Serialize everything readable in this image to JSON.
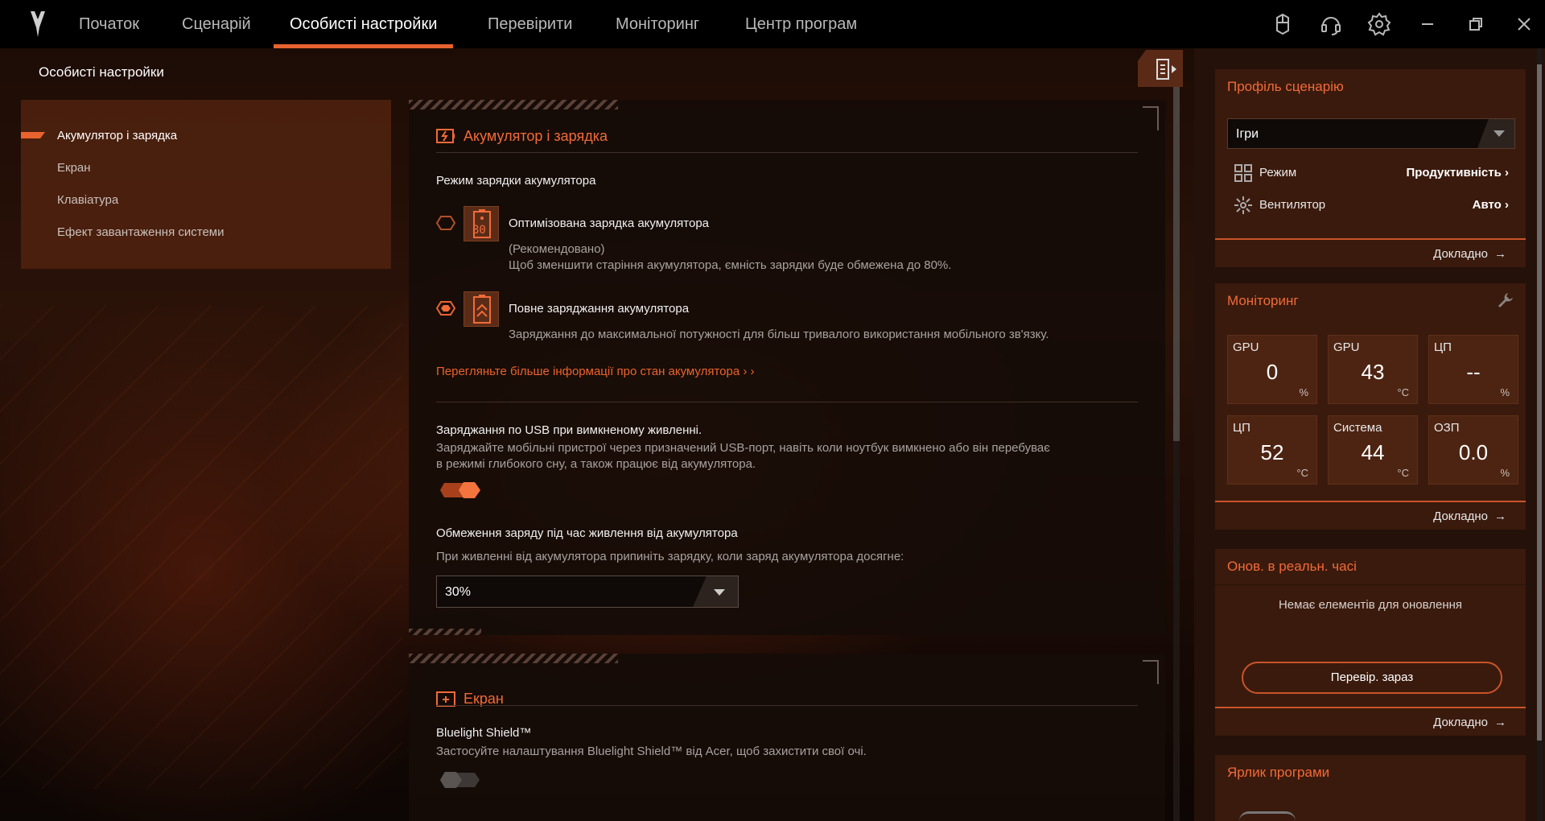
{
  "nav": {
    "tabs": [
      {
        "label": "Початок"
      },
      {
        "label": "Сценарій"
      },
      {
        "label": "Особисті настройки"
      },
      {
        "label": "Перевірити"
      },
      {
        "label": "Моніторинг"
      },
      {
        "label": "Центр програм"
      }
    ],
    "active_tab": "Особисті настройки"
  },
  "page_title": "Особисті настройки",
  "left_menu": {
    "items": [
      {
        "label": "Акумулятор і зарядка"
      },
      {
        "label": "Екран"
      },
      {
        "label": "Клавіатура"
      },
      {
        "label": "Ефект завантаження системи"
      }
    ],
    "active": "Акумулятор і зарядка"
  },
  "battery": {
    "title": "Акумулятор і зарядка",
    "mode_label": "Режим зарядки акумулятора",
    "optimized": {
      "icon_text": "80",
      "title": "Оптимізована зарядка акумулятора",
      "line1": "(Рекомендовано)",
      "line2": "Щоб зменшити старіння акумулятора, ємність зарядки буде обмежена до 80%.",
      "selected": false
    },
    "full": {
      "title": "Повне заряджання акумулятора",
      "desc": "Заряджання до максимальної потужності для більш тривалого використання мобільного зв'язку.",
      "selected": true
    },
    "info_link": "Перегляньте більше інформації про стан акумулятора ›  ›",
    "usb_title": "Заряджання по USB при вимкненому живленні.",
    "usb_desc1": "Заряджайте мобільні пристрої через призначений USB-порт, навіть коли ноутбук вимкнено або він перебуває",
    "usb_desc2": "в режимі глибокого сну, а також працює від акумулятора.",
    "usb_toggle_on": true,
    "limit_title": "Обмеження заряду під час живлення від акумулятора",
    "limit_desc": "При живленні від акумулятора припиніть зарядку, коли заряд акумулятора досягне:",
    "limit_value": "30%"
  },
  "screen": {
    "title": "Екран",
    "bluelight_title": "Bluelight Shield™",
    "bluelight_desc": "Застосуйте налаштування Bluelight Shield™ від Acer, щоб захистити свої очі.",
    "bluelight_on": false
  },
  "profile": {
    "title": "Профіль сценарію",
    "selected": "Ігри",
    "mode_label": "Режим",
    "mode_value": "Продуктивність  ›",
    "fan_label": "Вентилятор",
    "fan_value": "Авто  ›",
    "more": "Докладно"
  },
  "monitoring": {
    "title": "Моніторинг",
    "tiles": [
      {
        "label": "GPU",
        "value": "0",
        "unit": "%"
      },
      {
        "label": "GPU",
        "value": "43",
        "unit": "°C"
      },
      {
        "label": "ЦП",
        "value": "--",
        "unit": "%"
      },
      {
        "label": "ЦП",
        "value": "52",
        "unit": "°C"
      },
      {
        "label": "Система",
        "value": "44",
        "unit": "°C"
      },
      {
        "label": "ОЗП",
        "value": "0.0",
        "unit": "%"
      }
    ],
    "more": "Докладно"
  },
  "realtime": {
    "title": "Онов. в реальн. часі",
    "empty": "Немає елементів для оновлення",
    "button": "Перевір. зараз",
    "more": "Докладно"
  },
  "shortcut": {
    "title": "Ярлик програми"
  },
  "colors": {
    "accent": "#e9632e",
    "card": "#3a1a0d",
    "tile": "#4d2412"
  }
}
